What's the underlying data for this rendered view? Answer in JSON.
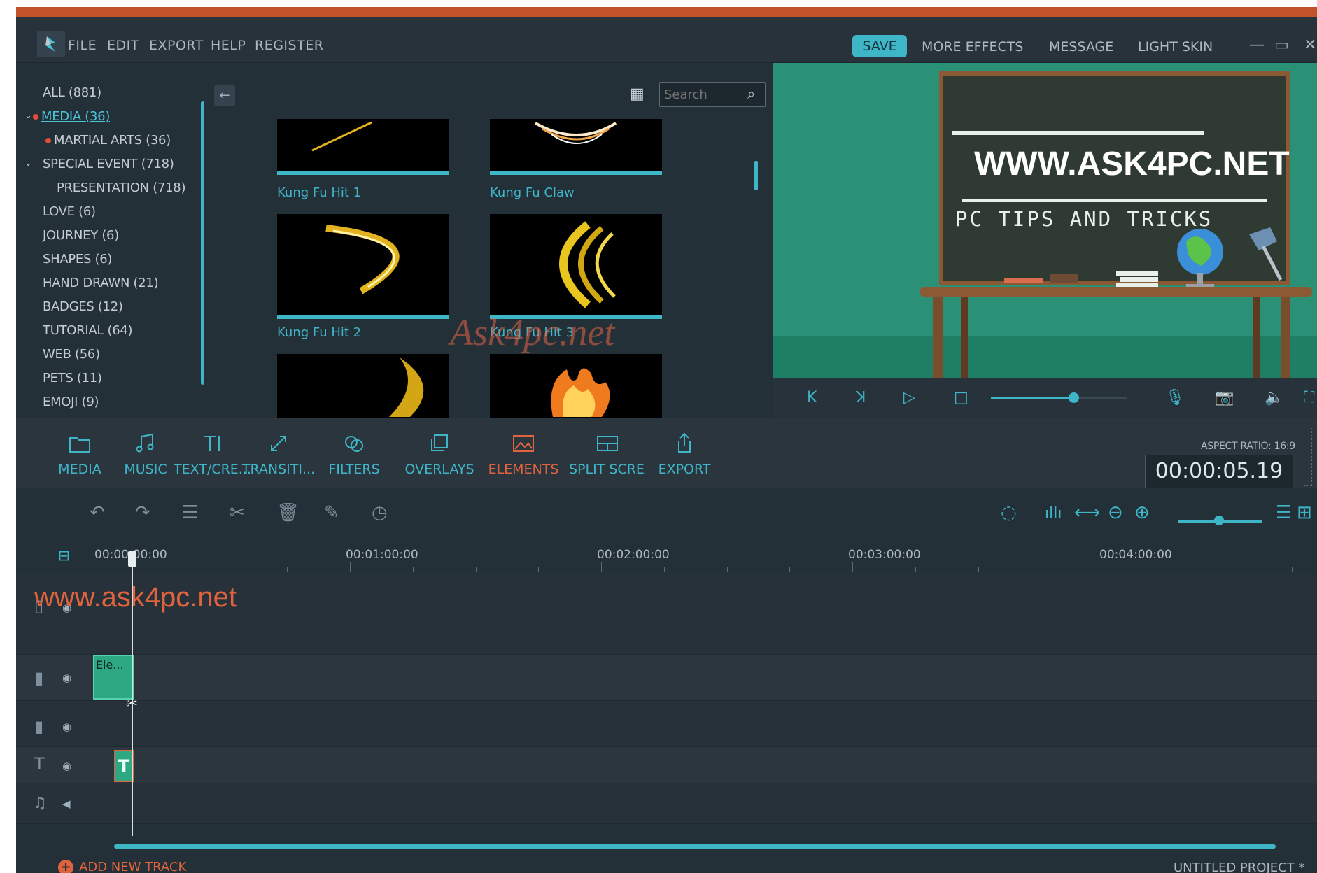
{
  "menu": {
    "items": [
      "FILE",
      "EDIT",
      "EXPORT",
      "HELP",
      "REGISTER"
    ],
    "save": "SAVE",
    "right_items": [
      "MORE EFFECTS",
      "MESSAGE",
      "LIGHT SKIN"
    ],
    "window_controls": [
      "—",
      "▭",
      "✕"
    ]
  },
  "library": {
    "categories": [
      "ALL (881)",
      "MEDIA (36)",
      "MARTIAL ARTS (36)",
      "SPECIAL EVENT (718)",
      "PRESENTATION (718)",
      "LOVE (6)",
      "JOURNEY (6)",
      "SHAPES (6)",
      "HAND DRAWN (21)",
      "BADGES (12)",
      "TUTORIAL (64)",
      "WEB (56)",
      "PETS (11)",
      "EMOJI (9)"
    ],
    "search_placeholder": "Search",
    "thumbnails": [
      "Kung Fu Hit 1",
      "Kung Fu Claw",
      "Kung Fu Hit 2",
      "Kung Fu Hit 3"
    ],
    "watermark": "Ask4pc.net"
  },
  "preview": {
    "board_title": "WWW.ASK4PC.NET",
    "board_subtitle": "PC TIPS AND TRICKS"
  },
  "tabs": [
    "MEDIA",
    "MUSIC",
    "TEXT/CRE...",
    "TRANSITI...",
    "FILTERS",
    "OVERLAYS",
    "ELEMENTS",
    "SPLIT SCRE...",
    "EXPORT"
  ],
  "active_tab": "ELEMENTS",
  "aspect_ratio": "ASPECT RATIO: 16:9",
  "timecode": "00:00:05.19",
  "ruler": [
    "00:00:00:00",
    "00:01:00:00",
    "00:02:00:00",
    "00:03:00:00",
    "00:04:00:00"
  ],
  "timeline": {
    "watermark": "www.ask4pc.net",
    "element_clip": "Ele...",
    "text_clip": "T",
    "add_track": "ADD NEW TRACK",
    "project_name": "UNTITLED PROJECT *"
  },
  "colors": {
    "accent": "#3fb5c8",
    "active": "#e0633d",
    "background": "#243038",
    "preview_bg": "#2a9176"
  }
}
